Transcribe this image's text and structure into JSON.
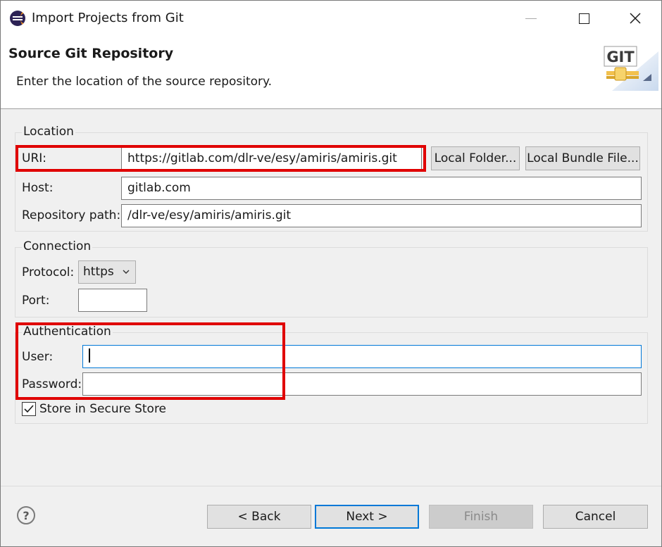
{
  "window": {
    "title": "Import Projects from Git"
  },
  "banner": {
    "title": "Source Git Repository",
    "description": "Enter the location of the source repository.",
    "logo_text": "GIT"
  },
  "location": {
    "group_label": "Location",
    "uri_label": "URI:",
    "uri_value": "https://gitlab.com/dlr-ve/esy/amiris/amiris.git",
    "local_folder_button": "Local Folder...",
    "local_bundle_button": "Local Bundle File...",
    "host_label": "Host:",
    "host_value": "gitlab.com",
    "repo_path_label": "Repository path:",
    "repo_path_value": "/dlr-ve/esy/amiris/amiris.git"
  },
  "connection": {
    "group_label": "Connection",
    "protocol_label": "Protocol:",
    "protocol_value": "https",
    "port_label": "Port:",
    "port_value": ""
  },
  "authentication": {
    "group_label": "Authentication",
    "user_label": "User:",
    "user_value": "",
    "password_label": "Password:",
    "password_value": "",
    "store_label": "Store in Secure Store",
    "store_checked": true
  },
  "footer": {
    "help_symbol": "?",
    "back_button": "< Back",
    "next_button": "Next >",
    "finish_button": "Finish",
    "cancel_button": "Cancel"
  },
  "colors": {
    "highlight": "#e00000",
    "focus": "#0078d7"
  }
}
